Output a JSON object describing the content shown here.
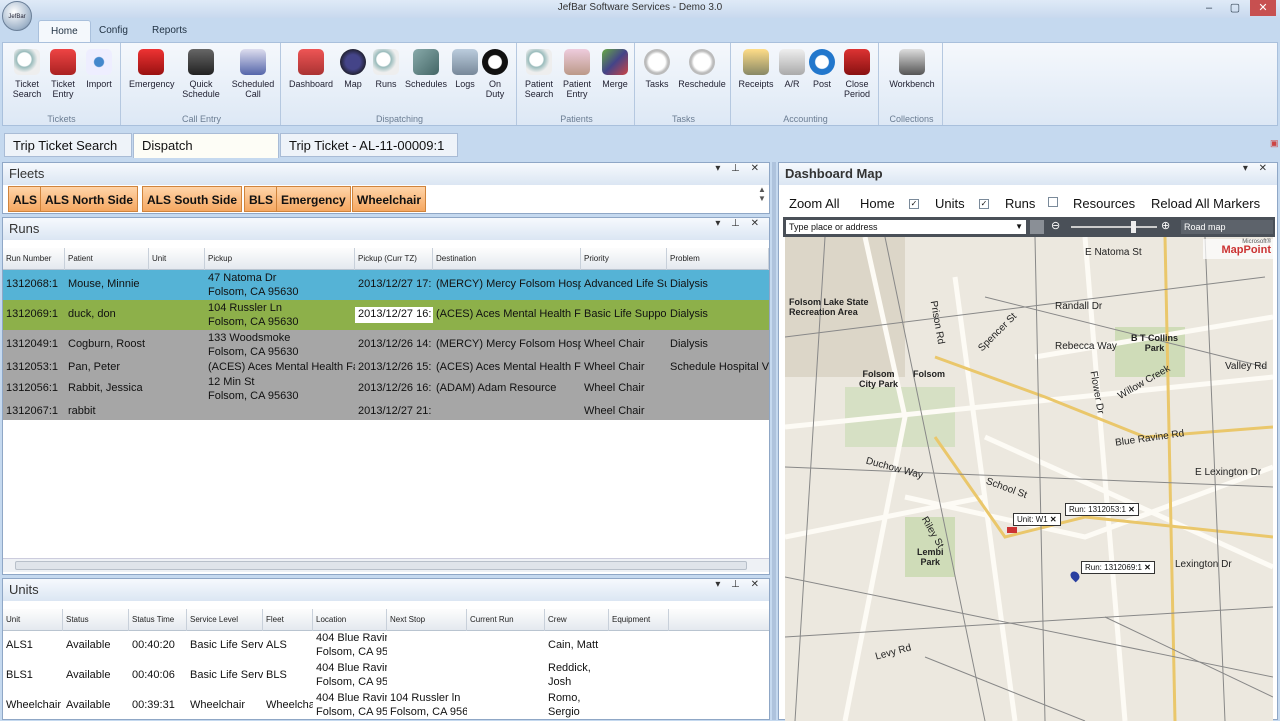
{
  "window": {
    "title": "JefBar Software Services - Demo 3.0",
    "logo_text": "JefBar",
    "min": "–",
    "max": "▢",
    "close": "✕"
  },
  "ribbon_tabs": [
    "Home",
    "Config",
    "Reports"
  ],
  "ribbon_groups": [
    {
      "label": "Tickets",
      "buttons": [
        "Ticket\nSearch",
        "Ticket\nEntry",
        "Import"
      ]
    },
    {
      "label": "Call Entry",
      "buttons": [
        "Emergency",
        "Quick\nSchedule",
        "Scheduled\nCall"
      ]
    },
    {
      "label": "Dispatching",
      "buttons": [
        "Dashboard",
        "Map",
        "Runs",
        "Schedules",
        "Logs",
        "On\nDuty"
      ]
    },
    {
      "label": "Patients",
      "buttons": [
        "Patient\nSearch",
        "Patient\nEntry",
        "Merge"
      ]
    },
    {
      "label": "Tasks",
      "buttons": [
        "Tasks",
        "Reschedule"
      ]
    },
    {
      "label": "Accounting",
      "buttons": [
        "Receipts",
        "A/R",
        "Post",
        "Close\nPeriod"
      ]
    },
    {
      "label": "Collections",
      "buttons": [
        "Workbench"
      ]
    }
  ],
  "doc_tabs": [
    "Trip Ticket Search",
    "Dispatch Dashboard",
    "Trip Ticket - AL-11-00009:1"
  ],
  "fleets": {
    "title": "Fleets",
    "items": [
      "ALS",
      "ALS North Side",
      "ALS South Side",
      "BLS",
      "Emergency",
      "Wheelchair"
    ]
  },
  "runs": {
    "title": "Runs",
    "columns": [
      "Run Number",
      "Patient",
      "Unit",
      "Pickup",
      "Pickup (Curr TZ)",
      "Destination",
      "Priority",
      "Problem"
    ],
    "rows": [
      {
        "run": "1312068:1",
        "patient": "Mouse, Minnie",
        "unit": "",
        "pickup1": "47 Natoma Dr",
        "pickup2": "Folsom, CA 95630",
        "time": "2013/12/27 17:",
        "dest": "(MERCY) Mercy Folsom Hospi",
        "priority": "Advanced Life Su",
        "problem": "Dialysis"
      },
      {
        "run": "1312069:1",
        "patient": "duck, don",
        "unit": "",
        "pickup1": "104 Russler Ln",
        "pickup2": "Folsom, CA 95630",
        "time": "2013/12/27 16:",
        "dest": "(ACES) Aces Mental Health Fa",
        "priority": "Basic Life Suppor",
        "problem": "Dialysis"
      },
      {
        "run": "1312049:1",
        "patient": "Cogburn, Roost",
        "unit": "",
        "pickup1": "133 Woodsmoke",
        "pickup2": "Folsom, CA 95630",
        "time": "2013/12/26 14:",
        "dest": "(MERCY) Mercy Folsom Hospi",
        "priority": "Wheel Chair",
        "problem": "Dialysis"
      },
      {
        "run": "1312053:1",
        "patient": "Pan, Peter",
        "unit": "",
        "pickup1": "(ACES) Aces Mental Health Fa",
        "pickup2": "",
        "time": "2013/12/26 15:",
        "dest": "(ACES) Aces Mental Health Fa",
        "priority": "Wheel Chair",
        "problem": "Schedule Hospital V"
      },
      {
        "run": "1312056:1",
        "patient": "Rabbit, Jessica",
        "unit": "",
        "pickup1": "12 Min St",
        "pickup2": "Folsom, CA 95630",
        "time": "2013/12/26 16:",
        "dest": "(ADAM) Adam Resource",
        "priority": "Wheel Chair",
        "problem": ""
      },
      {
        "run": "1312067:1",
        "patient": "rabbit",
        "unit": "",
        "pickup1": "",
        "pickup2": "",
        "time": "2013/12/27 21:",
        "dest": "",
        "priority": "Wheel Chair",
        "problem": ""
      }
    ]
  },
  "units": {
    "title": "Units",
    "columns": [
      "Unit",
      "Status",
      "Status Time",
      "Service Level",
      "Fleet",
      "Location",
      "Next Stop",
      "Current Run",
      "Crew",
      "Equipment"
    ],
    "rows": [
      {
        "unit": "ALS1",
        "status": "Available",
        "time": "00:40:20",
        "level": "Basic Life Servi",
        "fleet": "ALS",
        "loc1": "404 Blue Ravir",
        "loc2": "Folsom, CA 95",
        "next1": "",
        "next2": "",
        "run": "",
        "crew1": "Cain, Matt",
        "crew2": ""
      },
      {
        "unit": "BLS1",
        "status": "Available",
        "time": "00:40:06",
        "level": "Basic Life Servi",
        "fleet": "BLS",
        "loc1": "404 Blue Ravir",
        "loc2": "Folsom, CA 95",
        "next1": "",
        "next2": "",
        "run": "",
        "crew1": "Reddick,",
        "crew2": "Josh"
      },
      {
        "unit": "Wheelchair",
        "status": "Available",
        "time": "00:39:31",
        "level": "Wheelchair",
        "fleet": "Wheelcha",
        "loc1": "404 Blue Ravir",
        "loc2": "Folsom, CA 95",
        "next1": "104 Russler ln",
        "next2": "Folsom, CA 956",
        "run": "",
        "crew1": "Romo,",
        "crew2": "Sergio"
      }
    ]
  },
  "map": {
    "title": "Dashboard Map",
    "toolbar": {
      "zoom_all": "Zoom All",
      "home": "Home",
      "units": "Units",
      "runs": "Runs",
      "resources": "Resources",
      "reload": "Reload All Markers"
    },
    "search_placeholder": "Type place or address",
    "map_type": "Road map",
    "provider": "MapPoint",
    "provider_small": "Microsoft®",
    "labels": {
      "natoma": "E Natoma St",
      "lake": "Folsom Lake State\nRecreation Area",
      "collins": "B T Collins\nPark",
      "citypark": "Folsom\nCity Park",
      "folsom": "Folsom",
      "bluer": "Blue Ravine Rd",
      "lexn": "E Lexington Dr",
      "lex": "Lexington Dr",
      "lembi": "Lembi\nPark",
      "school": "School St",
      "willow": "Willow Creek",
      "rebecca": "Rebecca Way",
      "randall": "Randall Dr",
      "prison": "Prison Rd",
      "spencer": "Spencer St",
      "riley": "Riley St",
      "duchow": "Duchow Way",
      "levy": "Levy Rd",
      "valley": "Valley Rd",
      "flower": "Flower Dr"
    },
    "markers": {
      "run1": "Run: 1312053:1",
      "unit": "Unit: W1",
      "run2": "Run: 1312069:1"
    }
  }
}
